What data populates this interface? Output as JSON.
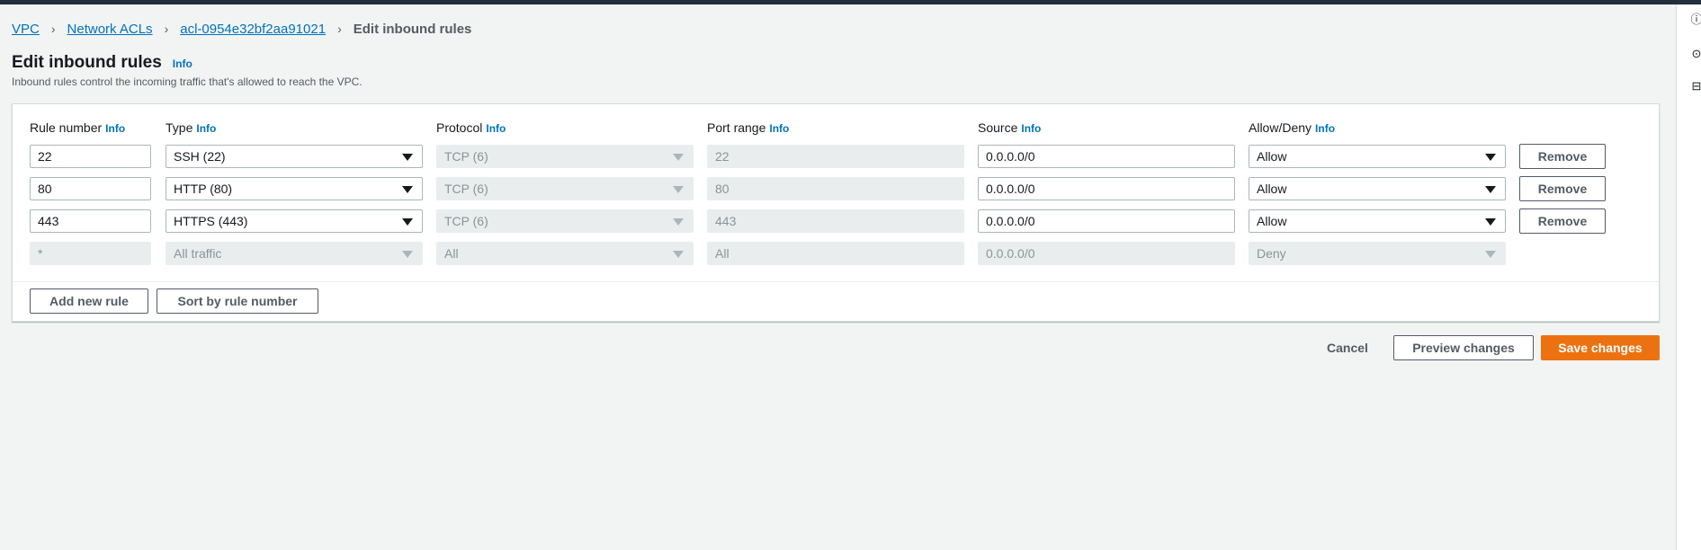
{
  "breadcrumb": {
    "items": [
      "VPC",
      "Network ACLs",
      "acl-0954e32bf2aa91021"
    ],
    "current": "Edit inbound rules",
    "separator": "›"
  },
  "page": {
    "title": "Edit inbound rules",
    "info": "Info",
    "description": "Inbound rules control the incoming traffic that's allowed to reach the VPC."
  },
  "columns": {
    "rule_number": "Rule number",
    "type": "Type",
    "protocol": "Protocol",
    "port_range": "Port range",
    "source": "Source",
    "allow_deny": "Allow/Deny",
    "info": "Info"
  },
  "rules": [
    {
      "rule_number": "22",
      "type": "SSH (22)",
      "protocol": "TCP (6)",
      "port_range": "22",
      "source": "0.0.0.0/0",
      "action": "Allow",
      "remove_label": "Remove"
    },
    {
      "rule_number": "80",
      "type": "HTTP (80)",
      "protocol": "TCP (6)",
      "port_range": "80",
      "source": "0.0.0.0/0",
      "action": "Allow",
      "remove_label": "Remove"
    },
    {
      "rule_number": "443",
      "type": "HTTPS (443)",
      "protocol": "TCP (6)",
      "port_range": "443",
      "source": "0.0.0.0/0",
      "action": "Allow",
      "remove_label": "Remove"
    }
  ],
  "default_rule": {
    "rule_number": "*",
    "type": "All traffic",
    "protocol": "All",
    "port_range": "All",
    "source": "0.0.0.0/0",
    "action": "Deny"
  },
  "panel_buttons": {
    "add": "Add new rule",
    "sort": "Sort by rule number"
  },
  "footer": {
    "cancel": "Cancel",
    "preview": "Preview changes",
    "save": "Save changes"
  },
  "colors": {
    "accent": "#0073bb",
    "primary": "#ec7211",
    "topbar": "#232f3e"
  },
  "icons": {
    "rail": [
      "info-circle-icon",
      "settings-circle-icon",
      "feedback-icon"
    ]
  }
}
